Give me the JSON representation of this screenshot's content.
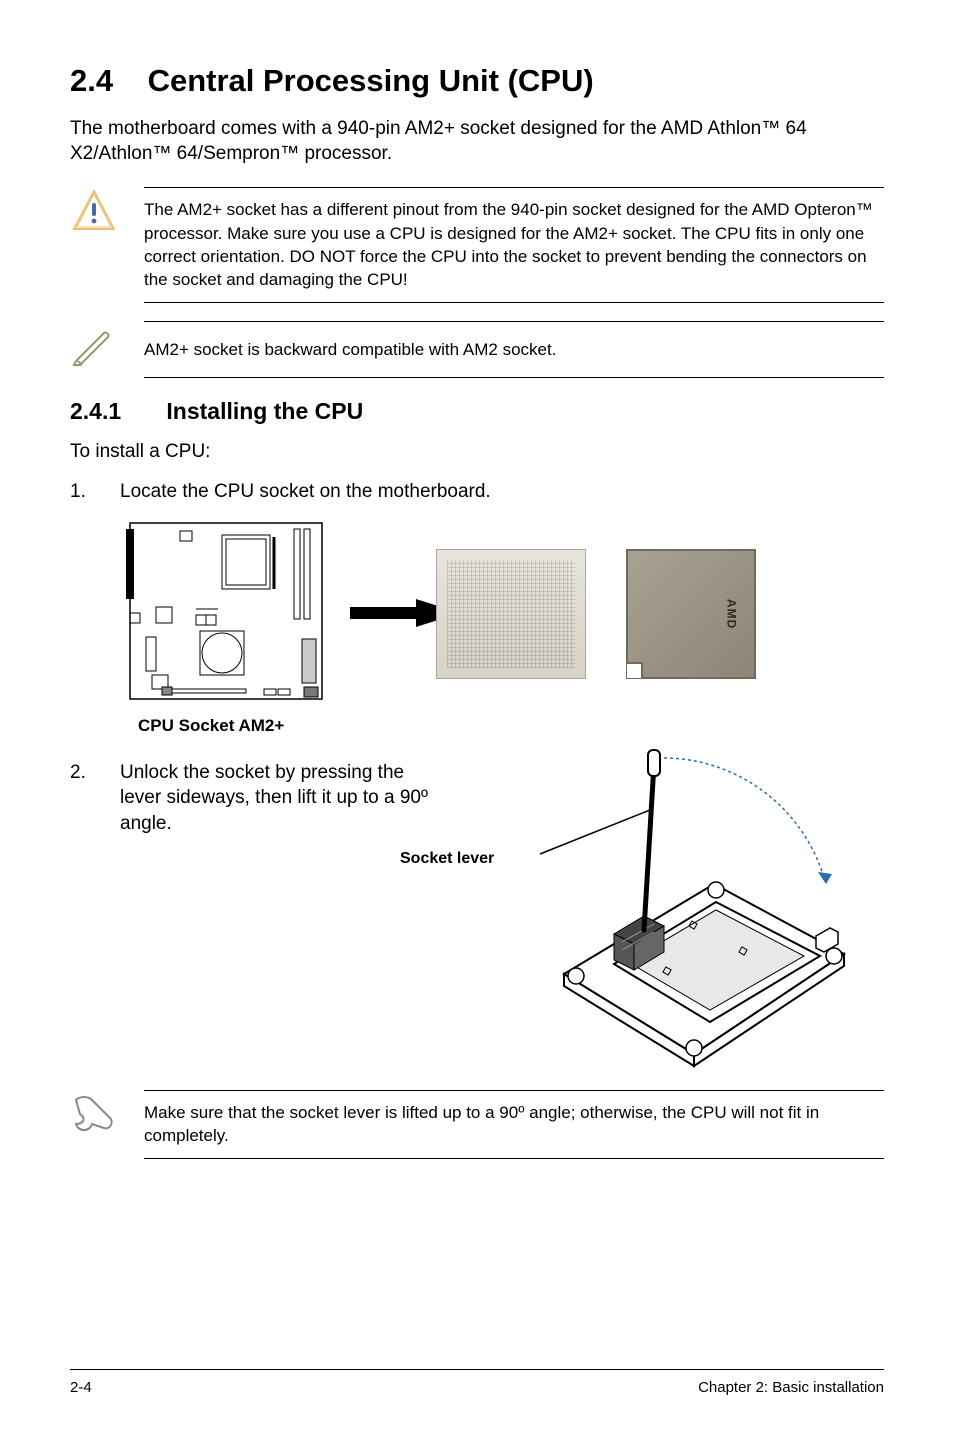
{
  "section": {
    "number": "2.4",
    "title": "Central Processing Unit (CPU)"
  },
  "intro": "The motherboard comes with a 940-pin AM2+ socket designed for the AMD Athlon™ 64 X2/Athlon™ 64/Sempron™ processor.",
  "caution_note": "The AM2+ socket has a different pinout from the 940-pin socket designed for the AMD Opteron™ processor. Make sure you use a CPU is designed for the AM2+ socket. The CPU fits in only one correct orientation. DO NOT force the CPU into the socket to prevent bending the connectors on the socket and damaging the CPU!",
  "pencil_note": "AM2+ socket is backward compatible with AM2 socket.",
  "subsection": {
    "number": "2.4.1",
    "title": "Installing the CPU"
  },
  "lead_in": "To install a CPU:",
  "steps": {
    "s1_num": "1.",
    "s1_text": "Locate the CPU socket on the motherboard.",
    "s2_num": "2.",
    "s2_text": "Unlock the socket by pressing the lever sideways, then lift it up to a 90º angle."
  },
  "board_caption": "CPU Socket AM2+",
  "lever_label": "Socket lever",
  "cpu_label": "AMD",
  "hand_note": "Make sure that the socket lever is lifted up to a 90º angle; otherwise, the CPU will not fit in completely.",
  "footer": {
    "left": "2-4",
    "right": "Chapter 2: Basic installation"
  }
}
